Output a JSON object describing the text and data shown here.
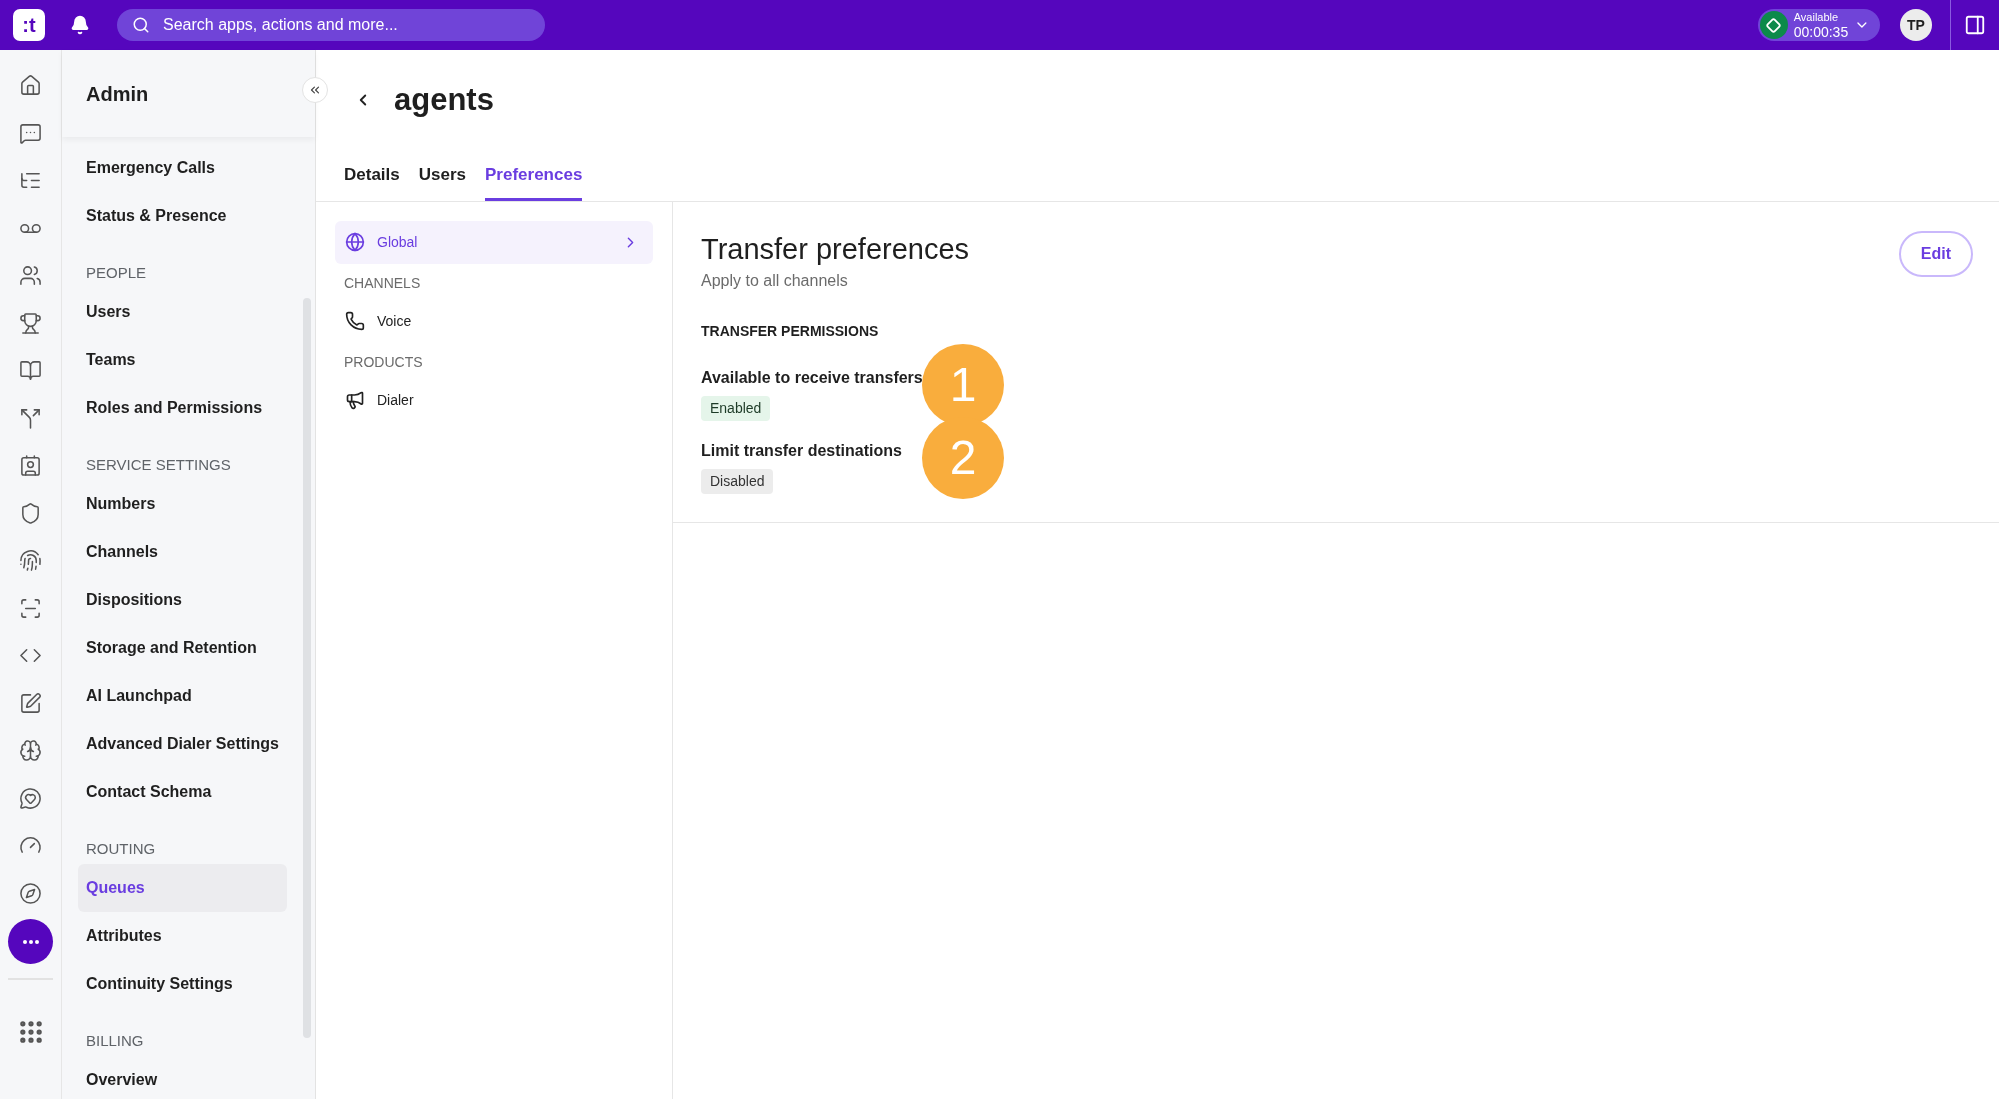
{
  "top_bar": {
    "logo": ":t",
    "search": {
      "placeholder": "Search apps, actions and more..."
    },
    "status": {
      "label": "Available",
      "timer": "00:00:35"
    },
    "avatar": "TP"
  },
  "sidebar": {
    "title": "Admin",
    "sections": [
      {
        "items": [
          {
            "label": "Emergency Calls",
            "selected": false
          },
          {
            "label": "Status & Presence",
            "selected": false
          }
        ]
      },
      {
        "title": "PEOPLE",
        "items": [
          {
            "label": "Users",
            "selected": false
          },
          {
            "label": "Teams",
            "selected": false
          },
          {
            "label": "Roles and Permissions",
            "selected": false
          }
        ]
      },
      {
        "title": "SERVICE SETTINGS",
        "items": [
          {
            "label": "Numbers",
            "selected": false
          },
          {
            "label": "Channels",
            "selected": false
          },
          {
            "label": "Dispositions",
            "selected": false
          },
          {
            "label": "Storage and Retention",
            "selected": false
          },
          {
            "label": "AI Launchpad",
            "selected": false
          },
          {
            "label": "Advanced Dialer Settings",
            "selected": false
          },
          {
            "label": "Contact Schema",
            "selected": false
          }
        ]
      },
      {
        "title": "ROUTING",
        "items": [
          {
            "label": "Queues",
            "selected": true
          },
          {
            "label": "Attributes",
            "selected": false
          },
          {
            "label": "Continuity Settings",
            "selected": false
          }
        ]
      },
      {
        "title": "BILLING",
        "items": [
          {
            "label": "Overview",
            "selected": false
          }
        ]
      }
    ]
  },
  "page": {
    "title": "agents",
    "tabs": [
      {
        "label": "Details",
        "selected": false
      },
      {
        "label": "Users",
        "selected": false
      },
      {
        "label": "Preferences",
        "selected": true
      }
    ]
  },
  "subnav": {
    "items": [
      {
        "kind": "item",
        "label": "Global",
        "selected": true
      },
      {
        "kind": "heading",
        "label": "CHANNELS"
      },
      {
        "kind": "item",
        "label": "Voice",
        "selected": false
      },
      {
        "kind": "heading",
        "label": "PRODUCTS"
      },
      {
        "kind": "item",
        "label": "Dialer",
        "selected": false
      }
    ]
  },
  "panel": {
    "title": "Transfer preferences",
    "subtitle": "Apply to all channels",
    "edit_button": "Edit",
    "section_title": "TRANSFER PERMISSIONS",
    "settings": [
      {
        "label": "Available to receive transfers",
        "status": "Enabled",
        "on": true,
        "callout": "1"
      },
      {
        "label": "Limit transfer destinations",
        "status": "Disabled",
        "on": false,
        "callout": "2"
      }
    ]
  }
}
